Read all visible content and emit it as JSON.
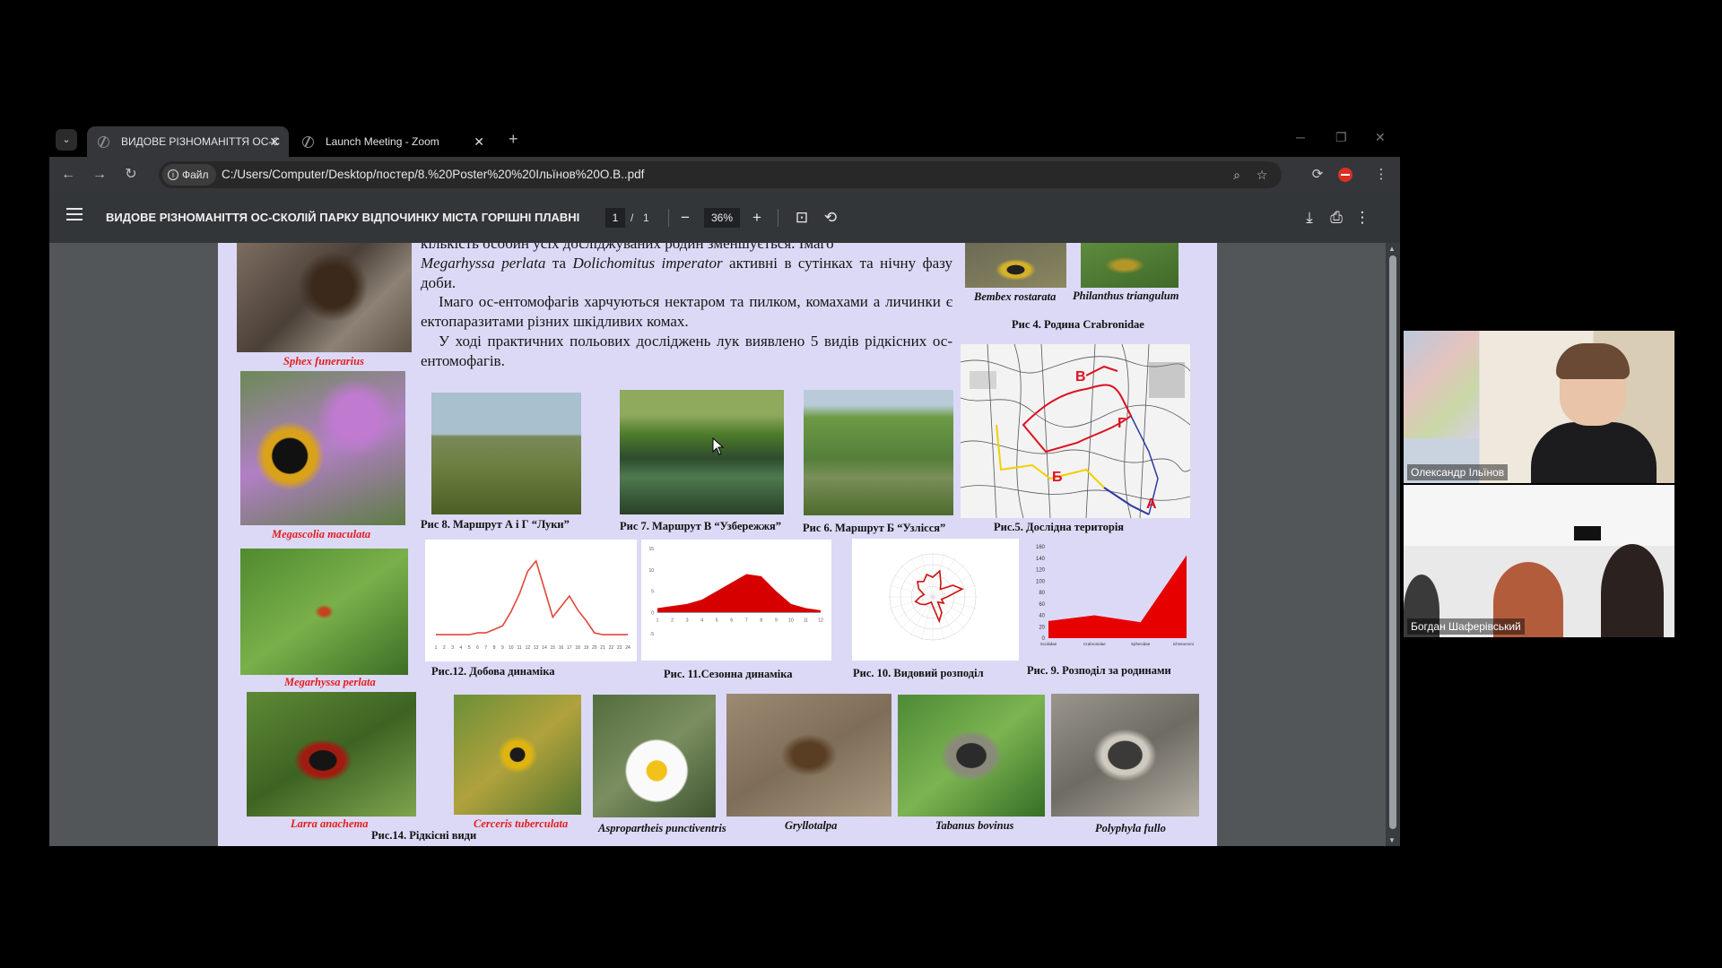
{
  "browser": {
    "tabs": [
      {
        "title": "ВИДОВЕ РІЗНОМАНІТТЯ ОС-С",
        "active": true
      },
      {
        "title": "Launch Meeting - Zoom",
        "active": false
      }
    ],
    "new_tab": "+",
    "close_glyph": "✕",
    "window_controls": {
      "minimize": "─",
      "restore": "❐",
      "close": "✕"
    },
    "site_chip": "Файл",
    "url": "C:/Users/Computer/Desktop/постер/8.%20Poster%20%20Ільїнов%20О.В..pdf",
    "icons": [
      "zoom-icon",
      "star-icon",
      "extensions-icon",
      "profile-icon",
      "menu-icon"
    ]
  },
  "pdf": {
    "title": "ВИДОВЕ РІЗНОМАНІТТЯ ОС-СКОЛІЙ ПАРКУ ВІДПОЧИНКУ МІСТА ГОРІШНІ ПЛАВНІ",
    "page_current": "1",
    "page_sep": "/",
    "page_total": "1",
    "zoom": "36%",
    "minus": "−",
    "plus": "+"
  },
  "poster": {
    "para1_line1": "кількість особин усіх досліджуваних родин зменшується. Імаго",
    "para1_em1": "Megarhyssa perlata",
    "para1_mid": " та ",
    "para1_em2": "Dolichomitus imperator",
    "para1_rest": " активні в сутінках та нічну фазу доби.",
    "para2": "Імаго ос-ентомофагів харчуються нектаром та пилком, комахами а личинки є ектопаразитами різних шкідливих комах.",
    "para3": "У ході практичних польових досліджень лук виявлено 5 видів рідкісних ос-ентомофагів.",
    "species": {
      "sphex": "Sphex funerarius",
      "megascolia": "Megascolia maculata",
      "megarhyssa": "Megarhyssa perlata",
      "larra": "Larra anachema",
      "cerceris": "Cerceris tuberculata",
      "aspro": "Aspropartheis punctiventris",
      "gryllotalpa": "Gryllotalpa",
      "tabanus": "Tabanus bovinus",
      "polyphyla": "Polyphyla fullo",
      "bembex": "Bembex rostarata",
      "philanthus": "Philanthus triangulum"
    },
    "captions": {
      "fig4": "Рис 4. Родина Crabronidae",
      "fig5": "Рис.5. Дослідна територія",
      "fig6": "Рис 6. Маршрут Б “Узлісся”",
      "fig7": "Рис 7. Маршрут В “Узбережжя”",
      "fig8": "Рис 8. Маршрут А і Г “Луки”",
      "fig9": "Рис. 9. Розподіл за родинами",
      "fig10": "Рис. 10. Видовий розподіл",
      "fig11": "Рис. 11.Сезонна динаміка",
      "fig12": "Рис.12. Добова динаміка",
      "fig14": "Рис.14. Рідкісні види"
    },
    "map_labels": {
      "a": "А",
      "b": "Б",
      "v": "В",
      "g": "Г"
    }
  },
  "chart_data": [
    {
      "type": "line",
      "title": "",
      "x": [
        1,
        2,
        3,
        4,
        5,
        6,
        7,
        8,
        9,
        10,
        11,
        12,
        13,
        14,
        15,
        16,
        17,
        18,
        19,
        20,
        21,
        22,
        23,
        24
      ],
      "values": [
        2,
        2,
        2,
        2,
        2,
        3,
        3,
        5,
        7,
        15,
        25,
        38,
        44,
        28,
        12,
        18,
        24,
        16,
        10,
        3,
        2,
        2,
        2,
        2
      ],
      "ylim": [
        0,
        50
      ],
      "color": "#e0463a"
    },
    {
      "type": "area",
      "title": "",
      "x": [
        1,
        2,
        3,
        4,
        5,
        6,
        7,
        8,
        9,
        10,
        11,
        12
      ],
      "values": [
        1,
        1.5,
        2,
        3,
        5,
        7,
        9,
        8.5,
        5,
        2,
        1,
        0.5
      ],
      "ylim": [
        -5,
        15
      ],
      "yticks": [
        15,
        10,
        5,
        0,
        -5
      ],
      "color": "#d60000"
    },
    {
      "type": "radar",
      "title": "",
      "note": "species distribution radar (labels too small to read)",
      "color": "#cc1111"
    },
    {
      "type": "area",
      "title": "",
      "categories": [
        "Scoliidae",
        "Crabronidae",
        "Sphecidae",
        "Ichneumonidae"
      ],
      "values": [
        30,
        40,
        28,
        145
      ],
      "ylim": [
        0,
        160
      ],
      "yticks": [
        160,
        140,
        120,
        100,
        80,
        60,
        40,
        20,
        0
      ],
      "color": "#e60000"
    }
  ],
  "participants": [
    {
      "name": "Олександр Ільїнов"
    },
    {
      "name": "Богдан Шаферівський"
    }
  ]
}
